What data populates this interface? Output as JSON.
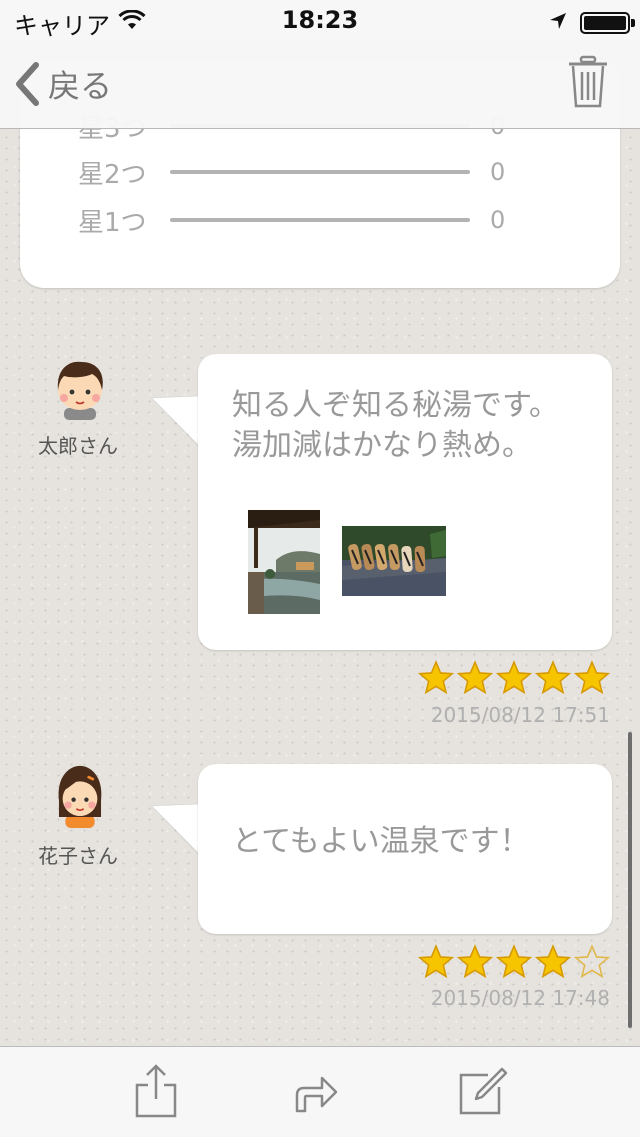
{
  "status_bar": {
    "carrier": "キャリア",
    "time": "18:23"
  },
  "nav": {
    "back_label": "戻る",
    "trash_icon": "trash-icon"
  },
  "rating_summary": {
    "rows": [
      {
        "label": "星3つ",
        "count": "0"
      },
      {
        "label": "星2つ",
        "count": "0"
      },
      {
        "label": "星1つ",
        "count": "0"
      }
    ]
  },
  "reviews": [
    {
      "user": "太郎さん",
      "text": "知る人ぞ知る秘湯です。湯加減はかなり熱め。",
      "photos": [
        "open-air-bath-photo",
        "wooden-sandals-photo"
      ],
      "rating": 5,
      "date": "2015/08/12 17:51"
    },
    {
      "user": "花子さん",
      "text": "とてもよい温泉です！",
      "photos": [],
      "rating": 4,
      "date": "2015/08/12 17:48"
    }
  ],
  "toolbar": {
    "items": [
      "share-icon",
      "forward-icon",
      "compose-icon"
    ]
  },
  "colors": {
    "star_fill": "#f7c400",
    "star_outline": "#e0b84a",
    "bar": "#b3b3b3"
  }
}
